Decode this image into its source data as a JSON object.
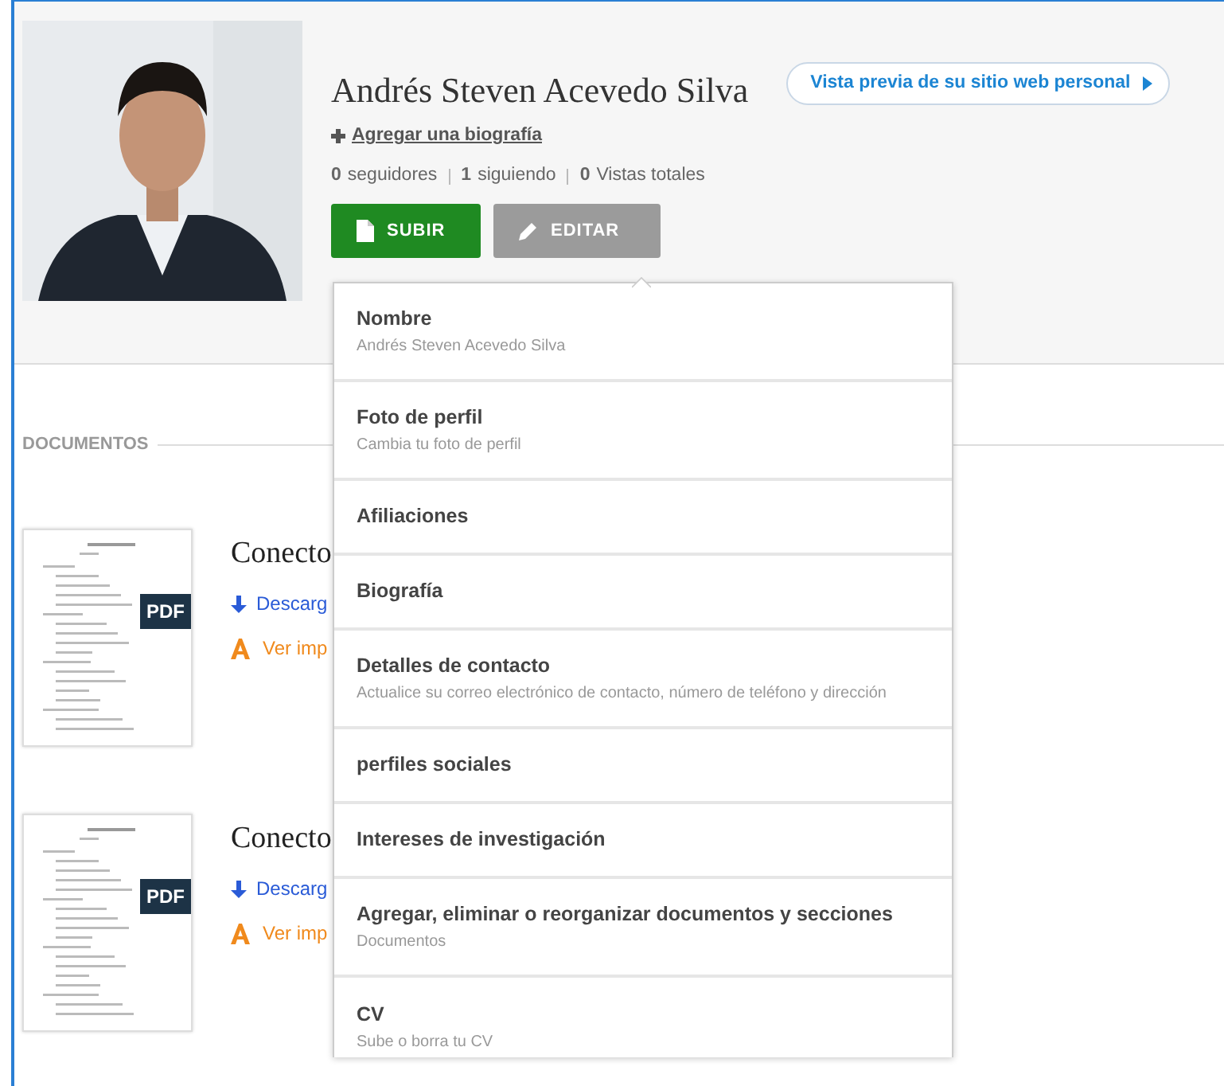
{
  "profile": {
    "name": "Andrés Steven Acevedo Silva",
    "preview_button": "Vista previa de su sitio web personal",
    "add_bio": "Agregar una biografía",
    "stats": [
      {
        "count": "0",
        "label": "seguidores"
      },
      {
        "count": "1",
        "label": "siguiendo"
      },
      {
        "count": "0",
        "label": "Vistas totales"
      }
    ],
    "buttons": [
      {
        "kind": "upload",
        "label": "SUBIR"
      },
      {
        "kind": "edit",
        "label": "EDITAR"
      }
    ]
  },
  "documents": {
    "heading": "DOCUMENTOS",
    "items": [
      {
        "title": "Conecto",
        "download": "Descarg",
        "view": "Ver imp",
        "badge": "PDF"
      },
      {
        "title": "Conecto",
        "download": "Descarg",
        "view": "Ver imp",
        "badge": "PDF"
      }
    ]
  },
  "edit_menu": [
    {
      "title": "Nombre",
      "subtitle": "Andrés Steven Acevedo Silva"
    },
    {
      "title": "Foto de perfil",
      "subtitle": "Cambia tu foto de perfil"
    },
    {
      "title": "Afiliaciones"
    },
    {
      "title": "Biografía"
    },
    {
      "title": "Detalles de contacto",
      "subtitle": "Actualice su correo electrónico de contacto, número de teléfono y dirección"
    },
    {
      "title": "perfiles sociales"
    },
    {
      "title": "Intereses de investigación"
    },
    {
      "title": "Agregar, eliminar o reorganizar documentos y secciones",
      "subtitle": "Documentos"
    },
    {
      "title": "CV",
      "subtitle": "Sube o borra tu CV"
    }
  ]
}
